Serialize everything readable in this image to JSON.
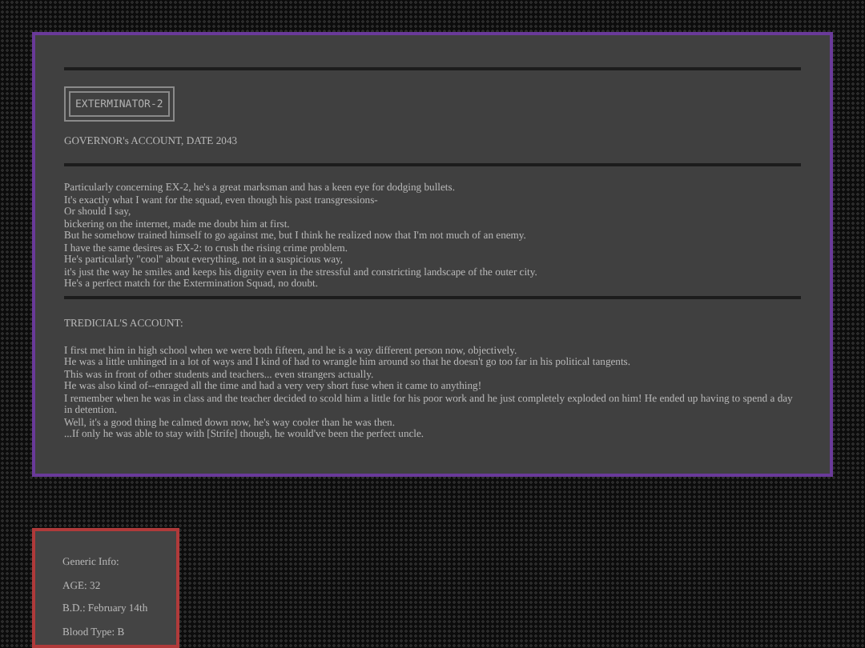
{
  "profile": {
    "tag": "EXTERMINATOR-2",
    "governor_heading": "GOVERNOR's ACCOUNT, DATE 2043",
    "governor_lines": [
      "Particularly concerning EX-2, he's a great marksman and has a keen eye for dodging bullets.",
      "It's exactly what I want for the squad, even though his past transgressions-",
      "Or should I say,",
      "bickering on the internet, made me doubt him at first.",
      "But he somehow trained himself to go against me, but I think he realized now that I'm not much of an enemy.",
      "I have the same desires as EX-2: to crush the rising crime problem.",
      "He's particularly \"cool\" about everything, not in a suspicious way,",
      "it's just the way he smiles and keeps his dignity even in the stressful and constricting landscape of the outer city.",
      "He's a perfect match for the Extermination Squad, no doubt."
    ],
    "tredicial_heading": "TREDICIAL'S ACCOUNT:",
    "tredicial_lines": [
      "I first met him in high school when we were both fifteen, and he is a way different person now, objectively.",
      "He was a little unhinged in a lot of ways and I kind of had to wrangle him around so that he doesn't go too far in his political tangents.",
      "This was in front of other students and teachers... even strangers actually.",
      "He was also kind of--enraged all the time and had a very very short fuse when it came to anything!",
      "I remember when he was in class and the teacher decided to scold him a little for his poor work and he just completely exploded on him! He ended up having to spend a day in detention.",
      "Well, it's a good thing he calmed down now, he's way cooler than he was then.",
      "...If only he was able to stay with [Strife] though, he would've been the perfect uncle."
    ]
  },
  "info_card": {
    "lines": [
      "Generic Info:",
      "AGE: 32",
      "B.D.: February 14th",
      "Blood Type: B"
    ]
  }
}
